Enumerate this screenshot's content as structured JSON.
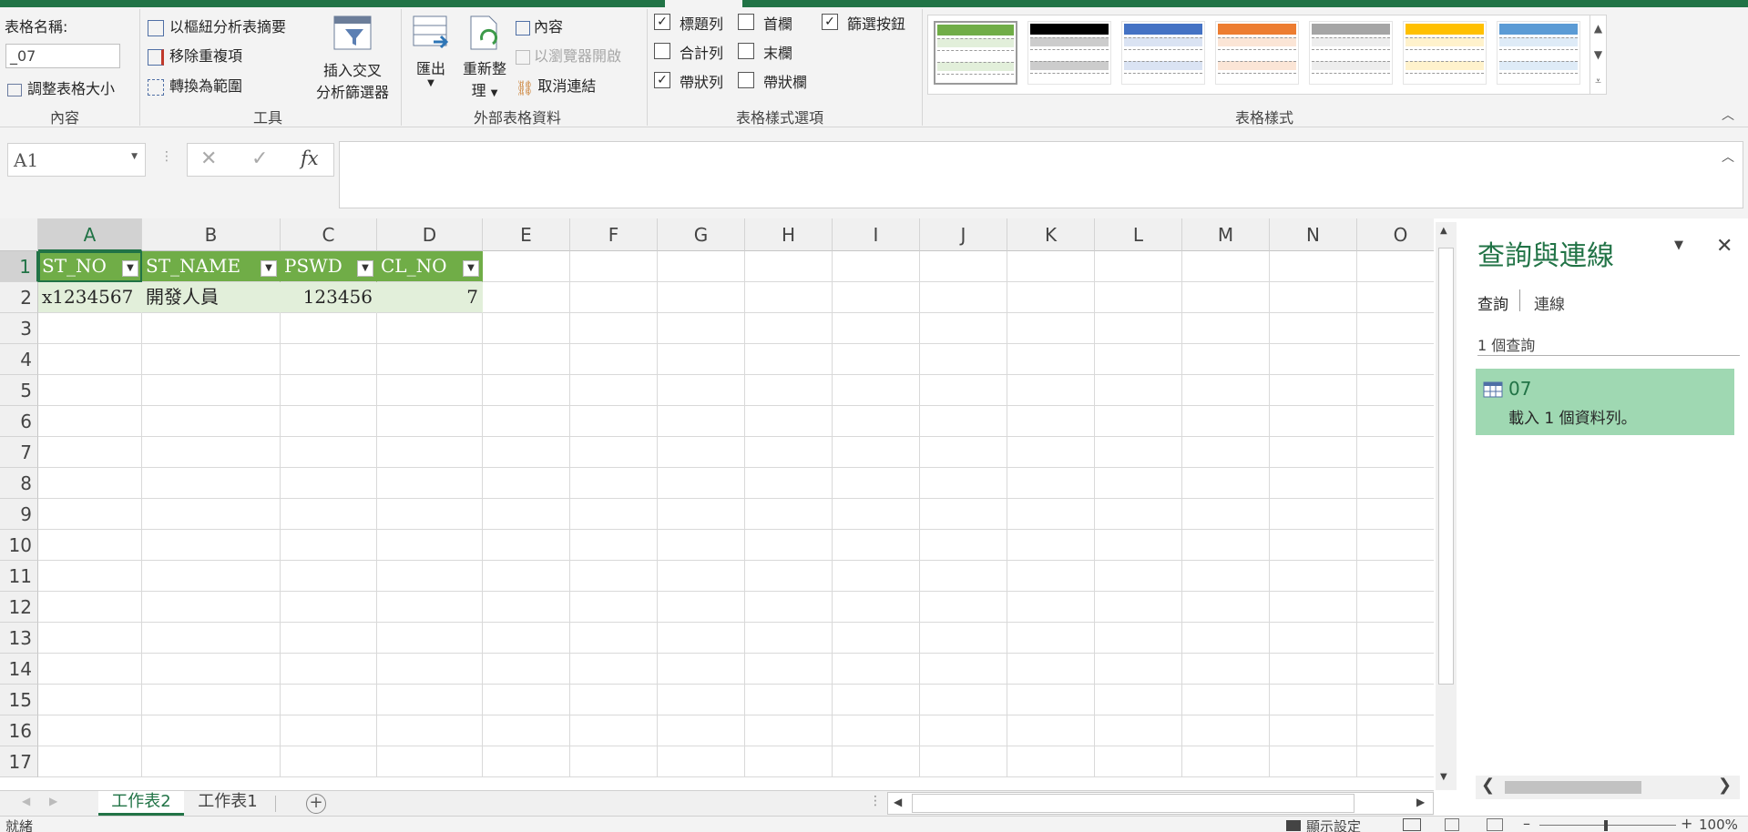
{
  "ribbon": {
    "group_properties": {
      "name_label": "表格名稱:",
      "name_value": "_07",
      "resize_label": "調整表格大小",
      "group_label": "內容"
    },
    "group_tools": {
      "pivot_label": "以樞紐分析表摘要",
      "remove_dup_label": "移除重複項",
      "convert_label": "轉換為範圍",
      "slicer_label_1": "插入交叉",
      "slicer_label_2": "分析篩選器",
      "group_label": "工具"
    },
    "group_external": {
      "export_label": "匯出",
      "refresh_label_1": "重新整",
      "refresh_label_2": "理",
      "properties_label": "內容",
      "open_browser_label": "以瀏覽器開啟",
      "unlink_label": "取消連結",
      "group_label": "外部表格資料"
    },
    "group_style_options": {
      "header_row": {
        "label": "標題列",
        "checked": true
      },
      "total_row": {
        "label": "合計列",
        "checked": false
      },
      "banded_rows": {
        "label": "帶狀列",
        "checked": true
      },
      "first_column": {
        "label": "首欄",
        "checked": false
      },
      "last_column": {
        "label": "末欄",
        "checked": false
      },
      "banded_columns": {
        "label": "帶狀欄",
        "checked": false
      },
      "filter_button": {
        "label": "篩選按鈕",
        "checked": true
      },
      "group_label": "表格樣式選項"
    },
    "group_table_styles": {
      "group_label": "表格樣式",
      "swatch_colors": [
        "#70ad47",
        "#000000",
        "#4472c4",
        "#ed7d31",
        "#a5a5a5",
        "#ffc000",
        "#5b9bd5"
      ]
    }
  },
  "formula_bar": {
    "name_box": "A1",
    "cancel_glyph": "✕",
    "enter_glyph": "✓",
    "fx_glyph": "fx",
    "formula": ""
  },
  "sheet": {
    "columns": [
      "A",
      "B",
      "C",
      "D",
      "E",
      "F",
      "G",
      "H",
      "I",
      "J",
      "K",
      "L",
      "M",
      "N",
      "O"
    ],
    "rows": [
      "1",
      "2",
      "3",
      "4",
      "5",
      "6",
      "7",
      "8",
      "9",
      "10",
      "11",
      "12",
      "13",
      "14",
      "15",
      "16",
      "17"
    ],
    "table_headers": [
      "ST_NO",
      "ST_NAME",
      "PSWD",
      "CL_NO"
    ],
    "table_row": [
      "x1234567",
      "開發人員",
      "123456",
      "7"
    ]
  },
  "tabs": {
    "sheets": [
      "工作表2",
      "工作表1"
    ],
    "active": "工作表2",
    "add_glyph": "+"
  },
  "panel": {
    "title": "查詢與連線",
    "tab_queries": "查詢",
    "tab_connections": "連線",
    "count_label": "1 個查詢",
    "query_name": "07",
    "query_status": "載入 1 個資料列。"
  },
  "status_bar": {
    "ready": "就緒",
    "display_settings": "顯示設定",
    "zoom": "100%"
  },
  "colors": {
    "accent": "#217346",
    "table_header": "#70ad47",
    "table_band": "#e2efda",
    "query_card": "#9fd8b2"
  }
}
